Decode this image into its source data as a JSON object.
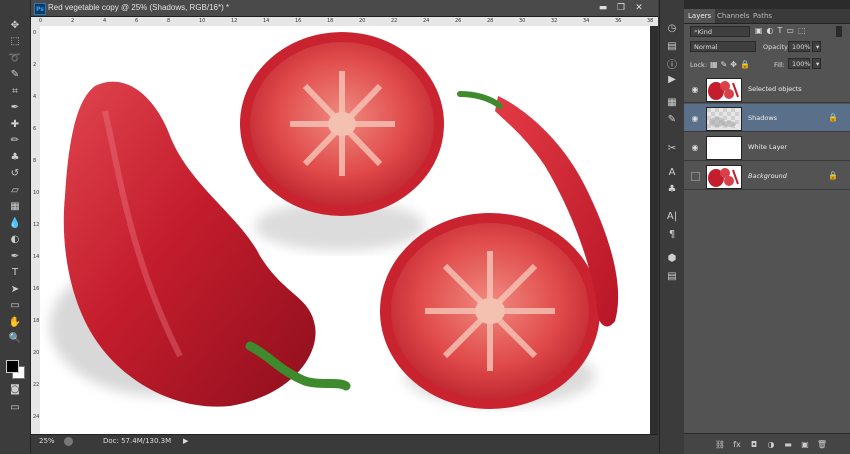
{
  "document": {
    "title": "Red vegetable copy @ 25% (Shadows, RGB/16*) *",
    "app_badge": "Ps",
    "zoom": "25%",
    "doc_info": "Doc: 57.4M/130.3M",
    "ruler_ticks": [
      "0",
      "2",
      "4",
      "6",
      "8",
      "10",
      "12",
      "14",
      "16",
      "18",
      "20",
      "22",
      "24",
      "26",
      "28",
      "30",
      "32",
      "34",
      "36",
      "38"
    ]
  },
  "window_controls": {
    "minimize": "▬",
    "restore": "❐",
    "close": "✕"
  },
  "toolbar": {
    "tools": [
      "move-tool",
      "marquee-tool",
      "lasso-tool",
      "quick-select-tool",
      "crop-tool",
      "eyedropper-tool",
      "healing-brush-tool",
      "brush-tool",
      "clone-stamp-tool",
      "history-brush-tool",
      "eraser-tool",
      "gradient-tool",
      "blur-tool",
      "dodge-tool",
      "pen-tool",
      "type-tool",
      "path-select-tool",
      "shape-tool",
      "hand-tool",
      "zoom-tool"
    ],
    "glyphs": [
      "✥",
      "⬚",
      "➰",
      "✎",
      "⌗",
      "✒",
      "✚",
      "✏",
      "♣",
      "↺",
      "▱",
      "▦",
      "💧",
      "◐",
      "✒",
      "T",
      "➤",
      "▭",
      "✋",
      "🔍"
    ]
  },
  "panel": {
    "tabs": [
      "Layers",
      "Channels",
      "Paths"
    ],
    "filter_kind": "Kind",
    "blend_mode": "Normal",
    "opacity_label": "Opacity:",
    "opacity_value": "100%",
    "lock_label": "Lock:",
    "fill_label": "Fill:",
    "fill_value": "100%",
    "layers": [
      {
        "name": "Selected objects",
        "visible": true,
        "selected": false,
        "locked": false,
        "italic": false
      },
      {
        "name": "Shadows",
        "visible": true,
        "selected": true,
        "locked": true,
        "italic": false
      },
      {
        "name": "White Layer",
        "visible": true,
        "selected": false,
        "locked": false,
        "italic": false
      },
      {
        "name": "Background",
        "visible": false,
        "selected": false,
        "locked": true,
        "italic": true
      }
    ],
    "bottom_icons": [
      "link-icon",
      "fx-icon",
      "mask-icon",
      "adjustment-icon",
      "folder-icon",
      "new-layer-icon",
      "trash-icon"
    ],
    "bottom_glyphs": [
      "⛓",
      "fx",
      "◘",
      "◑",
      "▬",
      "▣",
      "🗑"
    ]
  },
  "colors": {
    "accent_selected": "#5a6f89",
    "pepper": "#c8202f",
    "tomato": "#d63a3f",
    "stem": "#3f8a2c"
  }
}
